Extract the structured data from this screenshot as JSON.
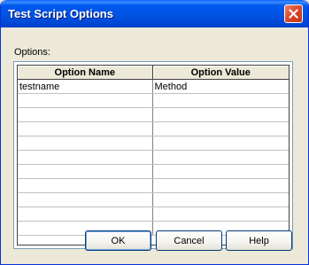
{
  "window": {
    "title": "Test Script Options"
  },
  "options_label": "Options:",
  "grid": {
    "columns": [
      "Option Name",
      "Option Value"
    ],
    "rows": [
      [
        "testname",
        "Method"
      ],
      [
        "",
        ""
      ],
      [
        "",
        ""
      ],
      [
        "",
        ""
      ],
      [
        "",
        ""
      ],
      [
        "",
        ""
      ],
      [
        "",
        ""
      ],
      [
        "",
        ""
      ],
      [
        "",
        ""
      ],
      [
        "",
        ""
      ],
      [
        "",
        ""
      ]
    ]
  },
  "buttons": {
    "ok": "OK",
    "cancel": "Cancel",
    "help": "Help"
  },
  "icons": {
    "close": "close-icon"
  },
  "colors": {
    "titlebar": "#0054e3",
    "close_button": "#d9472b",
    "dialog_bg": "#ece9d8"
  }
}
